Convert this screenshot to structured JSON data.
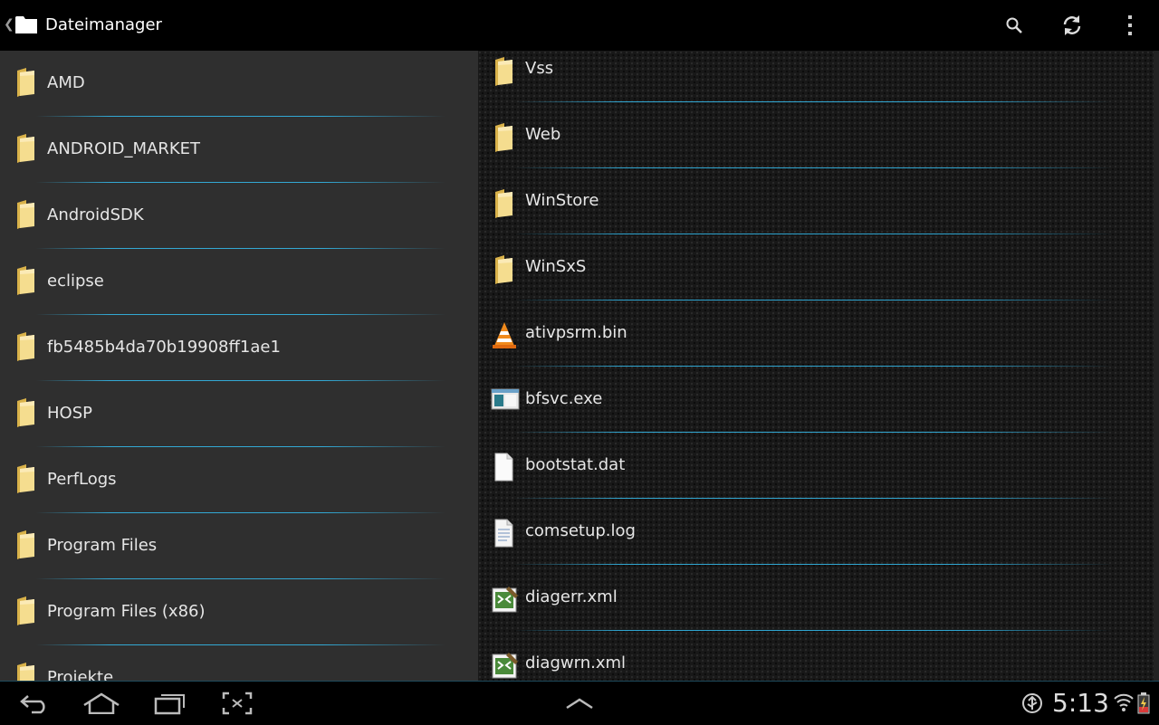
{
  "app": {
    "title": "Dateimanager",
    "up_icon": "chevron-left-icon",
    "app_icon": "folder-icon"
  },
  "actions": [
    {
      "name": "search",
      "icon": "search-icon"
    },
    {
      "name": "refresh",
      "icon": "refresh-icon"
    },
    {
      "name": "overflow-menu",
      "icon": "more-vertical-icon"
    }
  ],
  "left_pane": {
    "items": [
      {
        "label": "AMD",
        "icon": "folder-icon"
      },
      {
        "label": "ANDROID_MARKET",
        "icon": "folder-icon"
      },
      {
        "label": "AndroidSDK",
        "icon": "folder-icon"
      },
      {
        "label": "eclipse",
        "icon": "folder-icon"
      },
      {
        "label": "fb5485b4da70b19908ff1ae1",
        "icon": "folder-icon"
      },
      {
        "label": "HOSP",
        "icon": "folder-icon"
      },
      {
        "label": "PerfLogs",
        "icon": "folder-icon"
      },
      {
        "label": "Program Files",
        "icon": "folder-icon"
      },
      {
        "label": "Program Files (x86)",
        "icon": "folder-icon"
      },
      {
        "label": "Projekte",
        "icon": "folder-icon"
      }
    ]
  },
  "right_pane": {
    "items": [
      {
        "label": "Vss",
        "icon": "folder-icon"
      },
      {
        "label": "Web",
        "icon": "folder-icon"
      },
      {
        "label": "WinStore",
        "icon": "folder-icon"
      },
      {
        "label": "WinSxS",
        "icon": "folder-icon"
      },
      {
        "label": "ativpsrm.bin",
        "icon": "vlc-cone-icon"
      },
      {
        "label": "bfsvc.exe",
        "icon": "executable-icon"
      },
      {
        "label": "bootstat.dat",
        "icon": "blank-file-icon"
      },
      {
        "label": "comsetup.log",
        "icon": "text-file-icon"
      },
      {
        "label": "diagerr.xml",
        "icon": "xml-file-icon"
      },
      {
        "label": "diagwrn.xml",
        "icon": "xml-file-icon"
      }
    ]
  },
  "system_bar": {
    "back": "back-icon",
    "home": "home-icon",
    "recents": "recent-apps-icon",
    "screenshot": "screenshot-icon",
    "menu": "chevron-up-icon",
    "clock": "5:13",
    "status_icons": [
      "usb-debugging-icon",
      "wifi-icon",
      "battery-icon"
    ]
  },
  "colors": {
    "accent": "#33b5e5",
    "left_bg": "#2f2f2f",
    "right_bg": "#181818",
    "folder": "#f0d58a"
  }
}
